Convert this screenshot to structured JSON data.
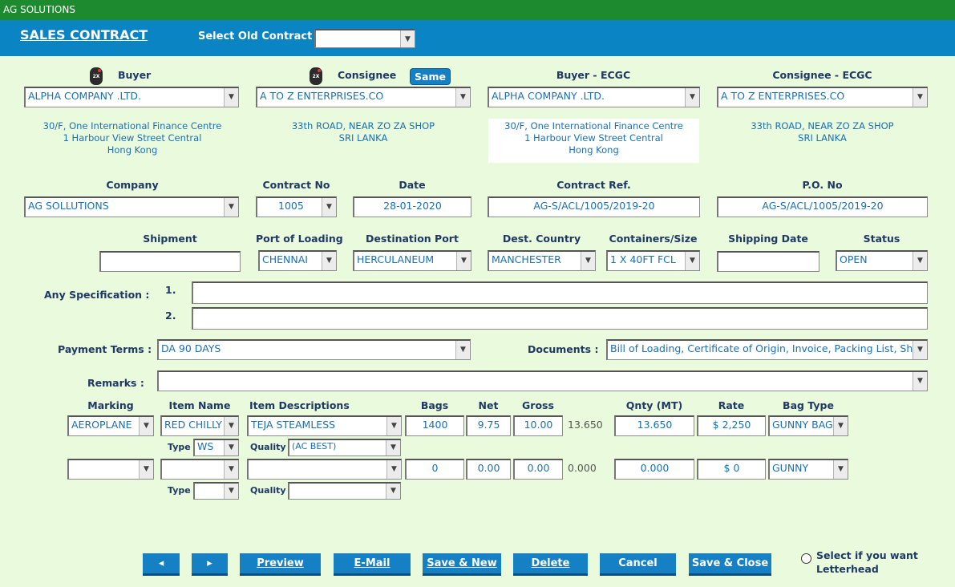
{
  "app_title": "AG SOLUTIONS",
  "form_title": "SALES CONTRACT",
  "old_contract": {
    "label": "Select Old Contract :",
    "value": ""
  },
  "parties": {
    "buyer": {
      "label": "Buyer",
      "value": "ALPHA COMPANY .LTD.",
      "address": [
        "30/F, One International Finance Centre",
        "1 Harbour View Street Central",
        "Hong Kong"
      ]
    },
    "consignee": {
      "label": "Consignee",
      "same_button": "Same",
      "value": "A TO Z ENTERPRISES.CO",
      "address": [
        "33th ROAD, NEAR ZO ZA SHOP",
        "SRI LANKA"
      ]
    },
    "buyer_ecgc": {
      "label": "Buyer - ECGC",
      "value": "ALPHA COMPANY .LTD.",
      "address": [
        "30/F, One International Finance Centre",
        "1 Harbour View Street Central",
        "Hong Kong"
      ]
    },
    "consignee_ecgc": {
      "label": "Consignee - ECGC",
      "value": "A TO Z ENTERPRISES.CO",
      "address": [
        "33th ROAD, NEAR ZO ZA SHOP",
        "SRI LANKA"
      ]
    },
    "icon_text": "2X"
  },
  "contract": {
    "company": {
      "label": "Company",
      "value": "AG SOLLUTIONS"
    },
    "contract_no": {
      "label": "Contract No",
      "value": "1005"
    },
    "date": {
      "label": "Date",
      "value": "28-01-2020"
    },
    "contract_ref": {
      "label": "Contract Ref.",
      "value": "AG-S/ACL/1005/2019-20"
    },
    "po_no": {
      "label": "P.O. No",
      "value": "AG-S/ACL/1005/2019-20"
    }
  },
  "shipping": {
    "shipment": {
      "label": "Shipment",
      "value": ""
    },
    "port_of_loading": {
      "label": "Port of Loading",
      "value": "CHENNAI"
    },
    "destination_port": {
      "label": "Destination Port",
      "value": "HERCULANEUM"
    },
    "dest_country": {
      "label": "Dest. Country",
      "value": "MANCHESTER"
    },
    "containers": {
      "label": "Containers/Size",
      "value": "1 X 40FT FCL"
    },
    "shipping_date": {
      "label": "Shipping Date",
      "value": ""
    },
    "status": {
      "label": "Status",
      "value": "OPEN"
    }
  },
  "specification": {
    "label": "Any Specification :",
    "n1": "1.",
    "n2": "2.",
    "line1": "",
    "line2": ""
  },
  "payment": {
    "label": "Payment Terms :",
    "value": "DA 90 DAYS"
  },
  "documents": {
    "label": "Documents :",
    "value": "Bill of Loading, Certificate of Origin, Invoice, Packing List, Ship"
  },
  "remarks": {
    "label": "Remarks :",
    "value": ""
  },
  "items": {
    "headers": {
      "marking": "Marking",
      "item_name": "Item Name",
      "item_desc": "Item Descriptions",
      "bags": "Bags",
      "net": "Net",
      "gross": "Gross",
      "qnty": "Qnty (MT)",
      "rate": "Rate",
      "bag_type": "Bag Type"
    },
    "type_label": "Type",
    "quality_label": "Quality",
    "rows": [
      {
        "marking": "AEROPLANE",
        "item_name": "RED CHILLY",
        "item_desc": "TEJA STEAMLESS",
        "bags": "1400",
        "net": "9.75",
        "gross": "10.00",
        "calc": "13.650",
        "qnty": "13.650",
        "rate": "$ 2,250",
        "bag_type": "GUNNY BAGS",
        "type": "WS",
        "quality": "(AC BEST)"
      },
      {
        "marking": "",
        "item_name": "",
        "item_desc": "",
        "bags": "0",
        "net": "0.00",
        "gross": "0.00",
        "calc": "0.000",
        "qnty": "0.000",
        "rate": "$ 0",
        "bag_type": "GUNNY",
        "type": "",
        "quality": ""
      }
    ]
  },
  "buttons": {
    "prev": "◂",
    "next": "▸",
    "preview": "Preview",
    "email": "E-Mail",
    "save_new": "Save & New",
    "delete": "Delete",
    "cancel": "Cancel",
    "save_close": "Save & Close"
  },
  "letterhead": {
    "line1": "Select if you want",
    "line2": "Letterhead"
  }
}
